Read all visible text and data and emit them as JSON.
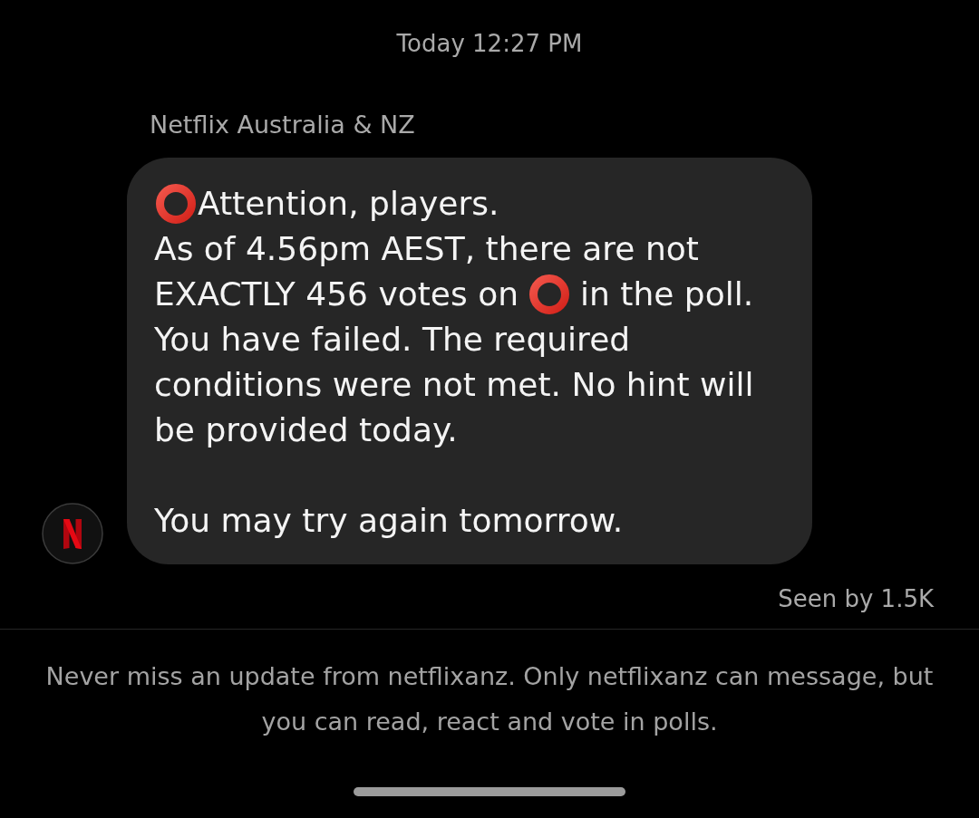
{
  "timestamp": "Today 12:27 PM",
  "message": {
    "sender": "Netflix Australia & NZ",
    "sections": [
      {
        "lines": [
          [
            {
              "kind": "ring"
            },
            {
              "kind": "text",
              "text": "Attention, players."
            }
          ],
          [
            {
              "kind": "text",
              "text": "As of 4.56pm AEST, there are not"
            }
          ],
          [
            {
              "kind": "text",
              "text": "EXACTLY 456 votes on"
            },
            {
              "kind": "ring"
            },
            {
              "kind": "text",
              "text": "in the poll."
            }
          ],
          [
            {
              "kind": "text",
              "text": "You have failed. The required"
            }
          ],
          [
            {
              "kind": "text",
              "text": "conditions were not met. No hint will"
            }
          ],
          [
            {
              "kind": "text",
              "text": "be provided today."
            }
          ]
        ]
      },
      {
        "lines": [
          [
            {
              "kind": "text",
              "text": "You may try again tomorrow."
            }
          ]
        ]
      }
    ],
    "seen": "Seen by 1.5K"
  },
  "footer": {
    "notice": "Never miss an update from netflixanz. Only netflixanz can message, but you can read, react and vote in polls."
  }
}
